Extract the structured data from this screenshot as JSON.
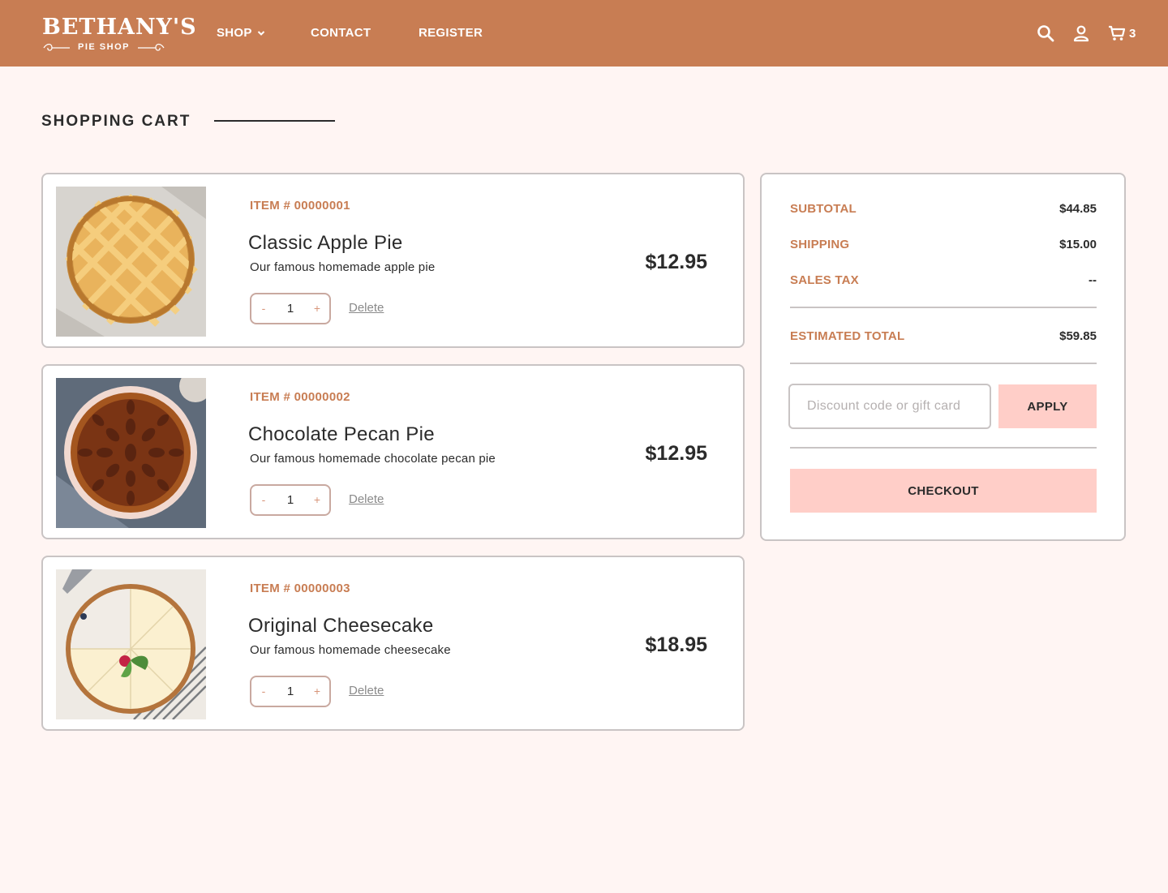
{
  "brand": {
    "name": "BETHANY'S",
    "tagline": "PIE SHOP"
  },
  "nav": {
    "shop": "SHOP",
    "contact": "CONTACT",
    "register": "REGISTER"
  },
  "header": {
    "cart_count": "3"
  },
  "page": {
    "title": "SHOPPING CART"
  },
  "cart": {
    "items": [
      {
        "item_no": "ITEM # 00000001",
        "name": "Classic Apple Pie",
        "description": "Our famous homemade apple pie",
        "qty": "1",
        "price": "$12.95",
        "delete_label": "Delete",
        "qty_minus": "-",
        "qty_plus": "+"
      },
      {
        "item_no": "ITEM # 00000002",
        "name": "Chocolate Pecan Pie",
        "description": "Our famous homemade chocolate pecan pie",
        "qty": "1",
        "price": "$12.95",
        "delete_label": "Delete",
        "qty_minus": "-",
        "qty_plus": "+"
      },
      {
        "item_no": "ITEM # 00000003",
        "name": "Original Cheesecake",
        "description": "Our famous homemade cheesecake",
        "qty": "1",
        "price": "$18.95",
        "delete_label": "Delete",
        "qty_minus": "-",
        "qty_plus": "+"
      }
    ]
  },
  "summary": {
    "subtotal_label": "SUBTOTAL",
    "subtotal": "$44.85",
    "shipping_label": "SHIPPING",
    "shipping": "$15.00",
    "tax_label": "SALES TAX",
    "tax": "--",
    "total_label": "ESTIMATED TOTAL",
    "total": "$59.85",
    "discount_placeholder": "Discount code or gift card",
    "apply_label": "APPLY",
    "checkout_label": "CHECKOUT"
  },
  "colors": {
    "brand": "#c87d53",
    "background": "#fff5f3",
    "button": "#ffcec8",
    "text": "#2b2b2b"
  },
  "icons": {
    "search": "search-icon",
    "account": "user-icon",
    "cart": "cart-icon",
    "dropdown": "chevron-down-icon"
  }
}
